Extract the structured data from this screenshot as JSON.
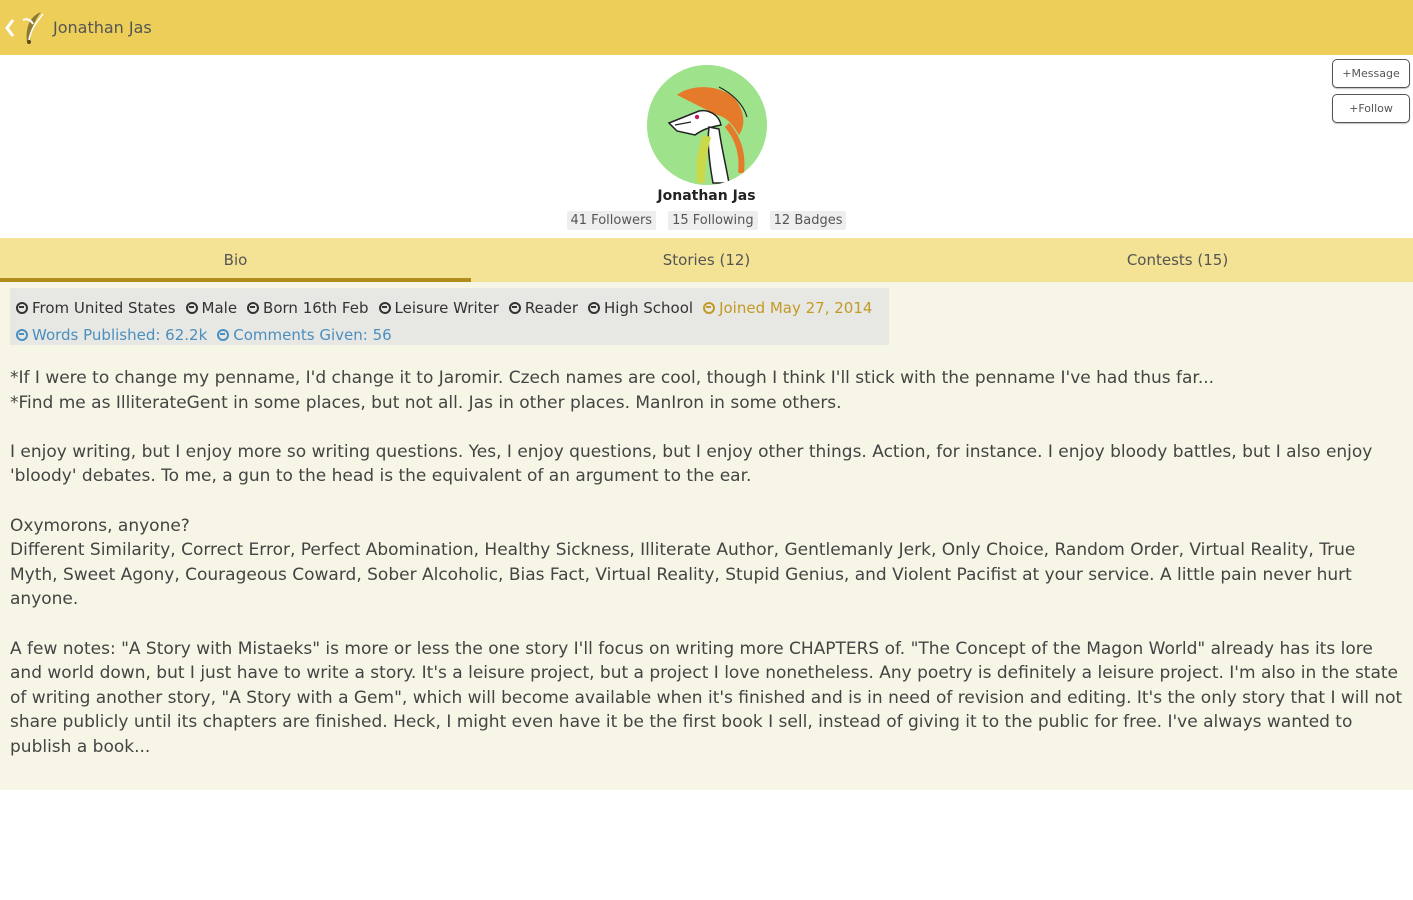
{
  "action_bar": {
    "title": "Jonathan Jas",
    "background": "#ecce58",
    "icons": [
      "chevron-left-icon",
      "quill-logo-icon"
    ]
  },
  "profile": {
    "name": "Jonathan Jas",
    "stats": [
      "41 Followers",
      "15 Following",
      "12 Badges"
    ],
    "message_label": "+Message",
    "follow_label": "+Follow",
    "avatar_bg": "#9ee38c"
  },
  "tabs": [
    {
      "label": "Bio",
      "active": true
    },
    {
      "label": "Stories (12)",
      "active": false
    },
    {
      "label": "Contests (15)",
      "active": false
    }
  ],
  "tags": {
    "line1": [
      {
        "text": "From United States",
        "style": "plain"
      },
      {
        "text": "Male",
        "style": "plain"
      },
      {
        "text": "Born 16th Feb",
        "style": "plain"
      },
      {
        "text": "Leisure Writer",
        "style": "plain"
      },
      {
        "text": "Reader",
        "style": "plain"
      },
      {
        "text": "High School",
        "style": "plain"
      },
      {
        "text": "Joined May 27, 2014",
        "style": "gold"
      }
    ],
    "line2": [
      {
        "text": "Words Published: 62.2k",
        "style": "blue"
      },
      {
        "text": "Comments Given: 56",
        "style": "blue"
      }
    ]
  },
  "bio": {
    "p1": "*If I were to change my penname, I'd change it to Jaromir. Czech names are cool, though I think I'll stick with the penname I've had thus far...",
    "p1b": "*Find me as IlliterateGent in some places, but not all. Jas in other places. ManIron in some others.",
    "p2": "I enjoy writing, but I enjoy more so writing questions. Yes, I enjoy questions, but I enjoy other things. Action, for instance. I enjoy bloody battles, but I also enjoy 'bloody' debates. To me, a gun to the head is the equivalent of an argument to the ear.",
    "p3a": "Oxymorons, anyone?",
    "p3b": "Different Similarity, Correct Error, Perfect Abomination, Healthy Sickness, Illiterate Author, Gentlemanly Jerk, Only Choice, Random Order, Virtual Reality, True Myth, Sweet Agony, Courageous Coward, Sober Alcoholic, Bias Fact, Virtual Reality, Stupid Genius, and Violent Pacifist at your service. A little pain never hurt anyone.",
    "p4": "A few notes: \"A Story with Mistaeks\" is more or less the one story I'll focus on writing more CHAPTERS of. \"The Concept of the Magon World\" already has its lore and world down, but I just have to write a story. It's a leisure project, but a project I love nonetheless. Any poetry is definitely a leisure project. I'm also in the state of writing another story, \"A Story with a Gem\", which will become available when it's finished and is in need of revision and editing. It's the only story that I will not share publicly until its chapters are finished. Heck, I might even have it be the first book I sell, instead of giving it to the public for free. I've always wanted to publish a book..."
  }
}
